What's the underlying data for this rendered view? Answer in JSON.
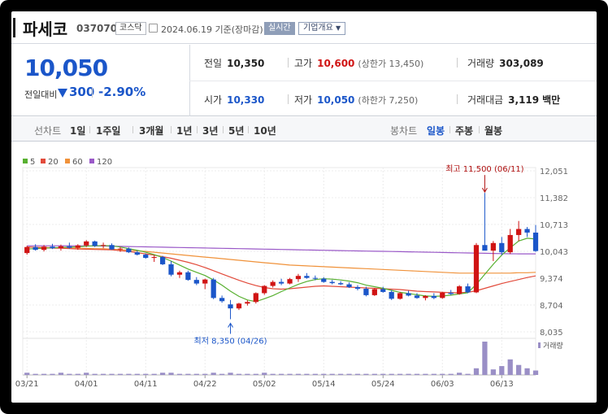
{
  "header": {
    "name": "파세코",
    "code": "037070",
    "market": "코스닥",
    "date": "2024.06.19",
    "date_suffix": "기준(장마감)",
    "realtime_label": "실시간",
    "company_label": "기업개요"
  },
  "summary": {
    "price": "10,050",
    "change_label": "전일대비",
    "change_value": "300",
    "change_rate": "-2.90%",
    "prev_close_label": "전일",
    "prev_close": "10,350",
    "high_label": "고가",
    "high": "10,600",
    "upper_limit": "(상한가 13,450)",
    "volume_label": "거래량",
    "volume": "303,089",
    "open_label": "시가",
    "open": "10,330",
    "low_label": "저가",
    "low": "10,050",
    "lower_limit": "(하한가 7,250)",
    "amount_label": "거래대금",
    "amount": "3,119",
    "amount_unit": "백만"
  },
  "periods": {
    "line_chart_label": "선차트",
    "items": [
      "1일",
      "1주일",
      "3개월",
      "1년",
      "3년",
      "5년",
      "10년"
    ],
    "candle_label": "봉차트",
    "candle_items": [
      "일봉",
      "주봉",
      "월봉"
    ],
    "active_candle": "일봉"
  },
  "colors": {
    "up": "#d01414",
    "down": "#1b56c9",
    "ma5": "#58b030",
    "ma20": "#e24b3b",
    "ma60": "#f0923a",
    "ma120": "#9a59c8"
  },
  "chart_data": {
    "type": "candlestick",
    "ma_legend": [
      {
        "label": "5",
        "color": "#58b030"
      },
      {
        "label": "20",
        "color": "#e24b3b"
      },
      {
        "label": "60",
        "color": "#f0923a"
      },
      {
        "label": "120",
        "color": "#9a59c8"
      }
    ],
    "y_ticks": [
      "12,051",
      "11,382",
      "10,713",
      "10,043",
      "9,374",
      "8,704",
      "8,035"
    ],
    "ylim": [
      8035,
      12051
    ],
    "x_ticks": [
      "03/21",
      "04/01",
      "04/11",
      "04/22",
      "05/02",
      "05/14",
      "05/24",
      "06/03",
      "06/13"
    ],
    "x_tick_index": [
      0,
      7,
      14,
      21,
      28,
      35,
      42,
      49,
      56
    ],
    "annotation_high": "최고 11,500 (06/11)",
    "annotation_high_index": 54,
    "annotation_high_value": 11500,
    "annotation_low": "최저 8,350 (04/26)",
    "annotation_low_index": 24,
    "annotation_low_value": 8350,
    "volume_label": "거래량",
    "candles": [
      [
        10000,
        10180,
        9960,
        10150
      ],
      [
        10150,
        10220,
        10060,
        10080
      ],
      [
        10080,
        10200,
        10040,
        10160
      ],
      [
        10160,
        10230,
        10100,
        10120
      ],
      [
        10120,
        10210,
        10060,
        10170
      ],
      [
        10170,
        10260,
        10110,
        10130
      ],
      [
        10130,
        10220,
        10080,
        10190
      ],
      [
        10190,
        10320,
        10150,
        10290
      ],
      [
        10290,
        10310,
        10150,
        10180
      ],
      [
        10180,
        10260,
        10120,
        10200
      ],
      [
        10200,
        10240,
        10080,
        10090
      ],
      [
        10090,
        10150,
        10030,
        10110
      ],
      [
        10110,
        10140,
        10000,
        10020
      ],
      [
        10020,
        10060,
        9940,
        9960
      ],
      [
        9960,
        9990,
        9860,
        9880
      ],
      [
        9880,
        9950,
        9780,
        9900
      ],
      [
        9900,
        9930,
        9700,
        9720
      ],
      [
        9720,
        9800,
        9420,
        9460
      ],
      [
        9460,
        9560,
        9380,
        9520
      ],
      [
        9520,
        9560,
        9310,
        9330
      ],
      [
        9330,
        9400,
        9200,
        9240
      ],
      [
        9240,
        9360,
        9100,
        9340
      ],
      [
        9340,
        9380,
        8850,
        8880
      ],
      [
        8880,
        8940,
        8760,
        8800
      ],
      [
        8720,
        8830,
        8350,
        8620
      ],
      [
        8620,
        8760,
        8580,
        8740
      ],
      [
        8740,
        8820,
        8690,
        8780
      ],
      [
        8780,
        9020,
        8740,
        9000
      ],
      [
        9000,
        9200,
        8960,
        9180
      ],
      [
        9180,
        9320,
        9140,
        9280
      ],
      [
        9280,
        9360,
        9200,
        9240
      ],
      [
        9240,
        9380,
        9220,
        9350
      ],
      [
        9350,
        9480,
        9280,
        9430
      ],
      [
        9430,
        9500,
        9360,
        9380
      ],
      [
        9380,
        9440,
        9320,
        9360
      ],
      [
        9360,
        9400,
        9260,
        9280
      ],
      [
        9280,
        9330,
        9220,
        9250
      ],
      [
        9250,
        9300,
        9200,
        9220
      ],
      [
        9220,
        9270,
        9130,
        9150
      ],
      [
        9150,
        9200,
        9070,
        9110
      ],
      [
        9110,
        9160,
        8920,
        8950
      ],
      [
        8950,
        9130,
        8930,
        9100
      ],
      [
        9100,
        9160,
        9010,
        9030
      ],
      [
        9030,
        9080,
        8830,
        8860
      ],
      [
        8860,
        9030,
        8840,
        9000
      ],
      [
        9000,
        9060,
        8920,
        8940
      ],
      [
        8940,
        9000,
        8860,
        8880
      ],
      [
        8880,
        8950,
        8820,
        8930
      ],
      [
        8930,
        9000,
        8850,
        8880
      ],
      [
        8880,
        9030,
        8860,
        9010
      ],
      [
        9010,
        9080,
        8950,
        8980
      ],
      [
        8980,
        9200,
        8960,
        9170
      ],
      [
        9170,
        9240,
        9000,
        9020
      ],
      [
        9020,
        10250,
        9000,
        10200
      ],
      [
        10200,
        11500,
        10100,
        10060
      ],
      [
        10060,
        10300,
        9800,
        10250
      ],
      [
        10250,
        10400,
        9950,
        10020
      ],
      [
        10020,
        10600,
        9980,
        10450
      ],
      [
        10450,
        10800,
        10300,
        10600
      ],
      [
        10600,
        10650,
        10400,
        10510
      ],
      [
        10510,
        10700,
        10030,
        10050
      ]
    ],
    "ma5": [
      10100,
      10110,
      10120,
      10130,
      10140,
      10150,
      10155,
      10170,
      10180,
      10185,
      10180,
      10150,
      10110,
      10070,
      10020,
      9960,
      9890,
      9800,
      9700,
      9600,
      9520,
      9440,
      9330,
      9200,
      9050,
      8920,
      8830,
      8790,
      8860,
      8940,
      9040,
      9130,
      9220,
      9290,
      9340,
      9360,
      9350,
      9330,
      9300,
      9260,
      9200,
      9160,
      9120,
      9070,
      9020,
      8990,
      8960,
      8930,
      8920,
      8930,
      8950,
      8980,
      9010,
      9220,
      9470,
      9720,
      9950,
      10130,
      10300,
      10370,
      10350
    ],
    "ma20": [
      10150,
      10140,
      10130,
      10125,
      10120,
      10110,
      10100,
      10095,
      10090,
      10085,
      10080,
      10060,
      10040,
      10010,
      9980,
      9950,
      9910,
      9870,
      9820,
      9770,
      9710,
      9640,
      9560,
      9480,
      9400,
      9320,
      9250,
      9190,
      9140,
      9110,
      9100,
      9110,
      9130,
      9150,
      9170,
      9180,
      9170,
      9160,
      9150,
      9140,
      9130,
      9120,
      9110,
      9100,
      9090,
      9070,
      9050,
      9040,
      9030,
      9020,
      9010,
      9010,
      9020,
      9060,
      9120,
      9180,
      9240,
      9290,
      9340,
      9390,
      9430
    ],
    "ma60": [
      10150,
      10145,
      10140,
      10135,
      10130,
      10125,
      10120,
      10115,
      10110,
      10105,
      10095,
      10085,
      10070,
      10055,
      10040,
      10020,
      10000,
      9980,
      9960,
      9940,
      9920,
      9900,
      9880,
      9860,
      9840,
      9820,
      9800,
      9780,
      9760,
      9740,
      9720,
      9700,
      9690,
      9680,
      9670,
      9660,
      9650,
      9640,
      9630,
      9620,
      9610,
      9600,
      9590,
      9580,
      9570,
      9560,
      9550,
      9540,
      9530,
      9520,
      9510,
      9500,
      9500,
      9500,
      9500,
      9500,
      9500,
      9500,
      9510,
      9510,
      9520
    ],
    "ma120": [
      10180,
      10180,
      10180,
      10180,
      10180,
      10180,
      10180,
      10178,
      10176,
      10174,
      10170,
      10166,
      10162,
      10158,
      10154,
      10150,
      10146,
      10142,
      10138,
      10134,
      10130,
      10126,
      10122,
      10118,
      10114,
      10110,
      10106,
      10102,
      10098,
      10094,
      10090,
      10086,
      10082,
      10078,
      10074,
      10070,
      10066,
      10062,
      10058,
      10054,
      10050,
      10046,
      10042,
      10038,
      10034,
      10030,
      10026,
      10022,
      10018,
      10014,
      10010,
      10006,
      10002,
      9998,
      9994,
      9990,
      9986,
      9982,
      9980,
      9980,
      9980
    ],
    "volume": [
      2,
      1,
      1,
      1,
      2,
      1,
      1,
      2,
      1,
      1,
      1,
      1,
      1,
      1,
      1,
      1,
      2,
      2,
      1,
      1,
      1,
      1,
      2,
      1,
      2,
      1,
      1,
      1,
      2,
      1,
      1,
      1,
      1,
      1,
      1,
      1,
      1,
      1,
      1,
      1,
      1,
      1,
      1,
      1,
      1,
      1,
      1,
      1,
      1,
      1,
      1,
      2,
      1,
      6,
      30,
      5,
      8,
      14,
      9,
      6,
      4
    ]
  }
}
